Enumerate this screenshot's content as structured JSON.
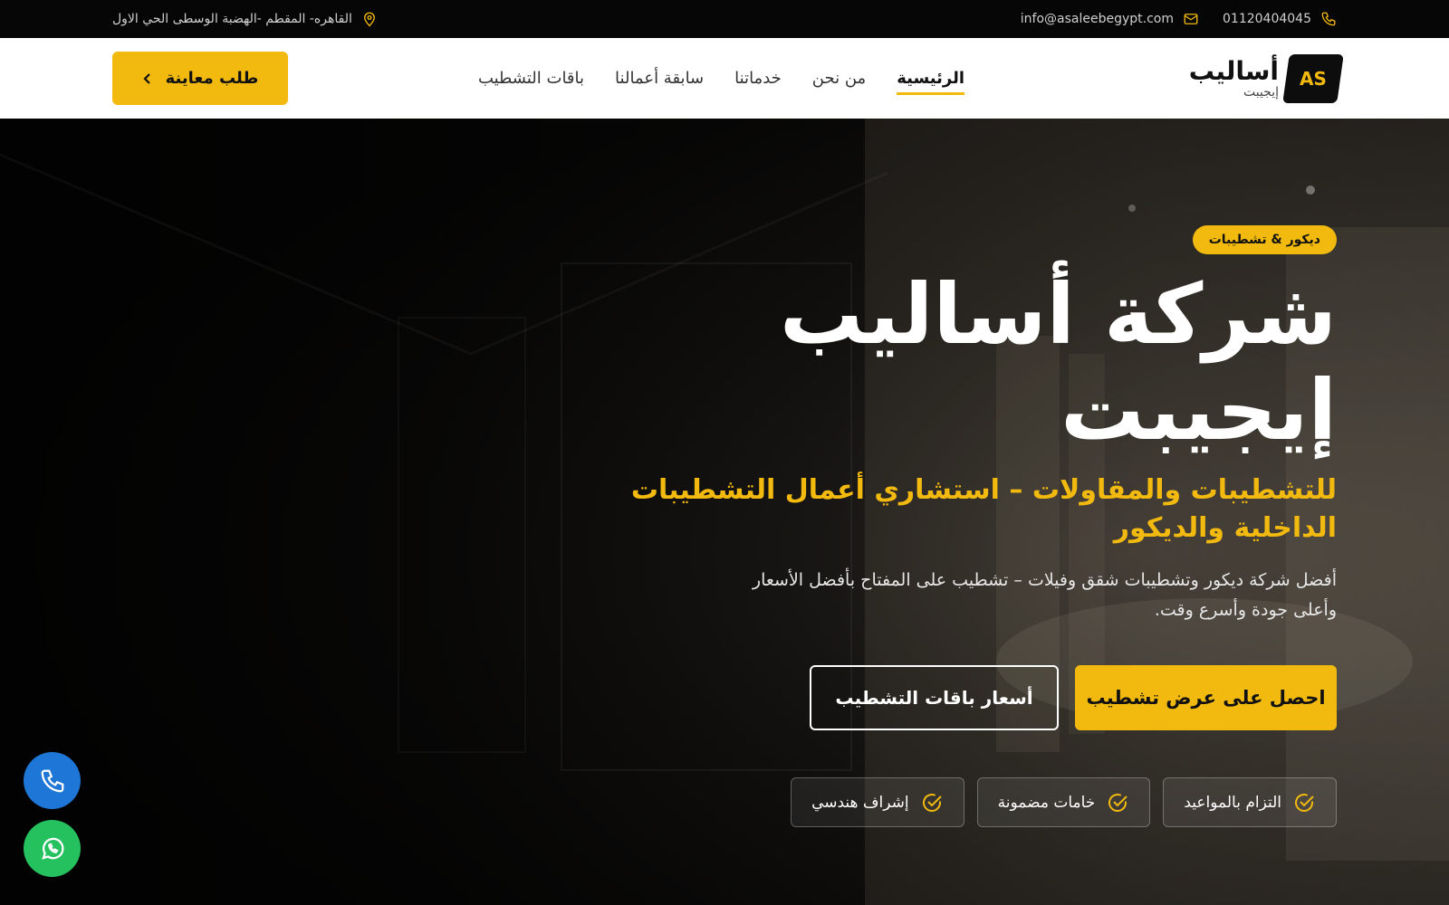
{
  "topbar": {
    "phone": "01120404045",
    "email": "info@asaleebegypt.com",
    "address": "القاهره- المقطم -الهضبة الوسطى الحي الاول"
  },
  "header": {
    "logo_badge": "AS",
    "logo_main": "أساليب",
    "logo_sub": "إيجيبت",
    "nav": [
      {
        "label": "الرئيسية",
        "active": true
      },
      {
        "label": "من نحن"
      },
      {
        "label": "خدماتنا"
      },
      {
        "label": "سابقة أعمالنا"
      },
      {
        "label": "باقات التشطيب"
      }
    ],
    "cta_label": "طلب معاينة"
  },
  "hero": {
    "badge": "ديكور & تشطيبات",
    "title_line1": "شركة أساليب",
    "title_line2": "إيجيبت",
    "subtitle": "للتشطيبات والمقاولات – استشاري أعمال التشطيبات الداخلية والديكور",
    "description": "أفضل شركة ديكور وتشطيبات شقق وفيلات – تشطيب على المفتاح بأفضل الأسعار وأعلى جودة وأسرع وقت.",
    "primary_button": "احصل على عرض تشطيب",
    "secondary_button": "أسعار باقات التشطيب",
    "features": [
      "التزام بالمواعيد",
      "خامات مضمونة",
      "إشراف هندسي"
    ]
  },
  "colors": {
    "accent": "#f2b90f",
    "topbar": "#060606",
    "phone_float": "#1e76d6",
    "whatsapp_float": "#25c15f"
  },
  "icons": [
    "phone-icon",
    "mail-icon",
    "location-pin-icon",
    "chevron-left-icon",
    "check-circle-icon",
    "whatsapp-icon"
  ]
}
